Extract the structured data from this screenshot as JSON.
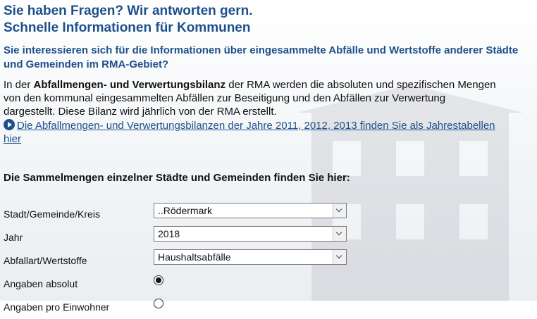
{
  "heading": {
    "line1": "Sie haben Fragen? Wir antworten gern.",
    "line2": "Schnelle Informationen für Kommunen"
  },
  "subheading": "Sie interessieren sich für die Informationen über eingesammelte Abfälle und Wertstoffe anderer Städte und Gemeinden im RMA-Gebiet?",
  "intro": {
    "line1_prefix": "In der ",
    "line1_bold": "Abfallmengen- und Verwertungsbilanz",
    "line1_suffix": " der RMA werden die absoluten und spezifischen Mengen",
    "line2": "von den kommunal eingesammelten Abfällen zur Beseitigung und den Abfällen zur Verwertung",
    "line3": "dargestellt. Diese Bilanz wird jährlich von der RMA erstellt."
  },
  "link": {
    "text_line1": "Die Abfallmengen- und Verwertungsbilanzen der Jahre 2011, 2012, 2013 finden Sie als Jahrestabellen",
    "text_line2": "hier",
    "icon": "play-circle-icon"
  },
  "section_title": "Die Sammelmengen einzelner Städte und Gemeinden finden Sie hier:",
  "form": {
    "city_label": "Stadt/Gemeinde/Kreis",
    "city_value": "..Rödermark",
    "year_label": "Jahr",
    "year_value": "2018",
    "waste_label": "Abfallart/Wertstoffe",
    "waste_value": "Haushaltsabfälle",
    "absolute_label": "Angaben absolut",
    "absolute_checked": true,
    "per_capita_label": "Angaben pro Einwohner",
    "per_capita_checked": false
  },
  "colors": {
    "accent": "#1d4f8c"
  }
}
